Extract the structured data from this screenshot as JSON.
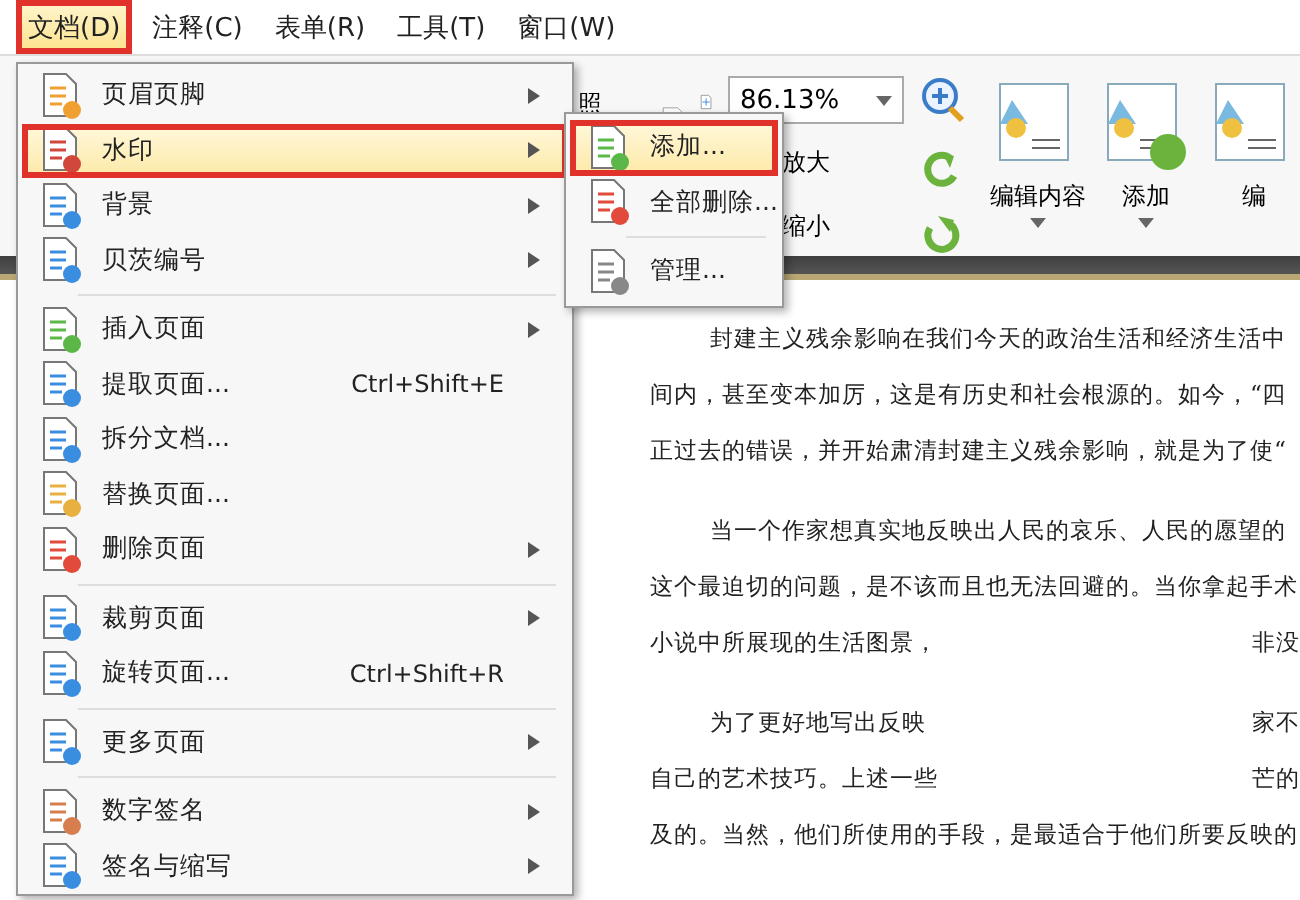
{
  "menu_bar": [
    {
      "label": "文档(D)",
      "selected": true,
      "outlined": true
    },
    {
      "label": "注释(C)",
      "selected": false,
      "outlined": false
    },
    {
      "label": "表单(R)",
      "selected": false,
      "outlined": false
    },
    {
      "label": "工具(T)",
      "selected": false,
      "outlined": false
    },
    {
      "label": "窗口(W)",
      "selected": false,
      "outlined": false
    }
  ],
  "ribbon": {
    "cut_label": "照",
    "zoom_field": {
      "value": "86.13%"
    },
    "zoom_in": "放大",
    "zoom_out": "缩小",
    "buttons": [
      {
        "label": "编辑内容",
        "dropdown": true
      },
      {
        "label": "添加",
        "dropdown": true
      },
      {
        "label": "编",
        "dropdown": false
      }
    ]
  },
  "document_menu": [
    {
      "kind": "item",
      "label": "页眉页脚",
      "submenu": true,
      "selected": false,
      "outlined": false
    },
    {
      "kind": "item",
      "label": "水印",
      "submenu": true,
      "selected": true,
      "outlined": true
    },
    {
      "kind": "item",
      "label": "背景",
      "submenu": true,
      "selected": false,
      "outlined": false
    },
    {
      "kind": "item",
      "label": "贝茨编号",
      "submenu": true,
      "selected": false,
      "outlined": false
    },
    {
      "kind": "separator"
    },
    {
      "kind": "item",
      "label": "插入页面",
      "submenu": true,
      "selected": false,
      "outlined": false
    },
    {
      "kind": "item",
      "label": "提取页面...",
      "shortcut": "Ctrl+Shift+E",
      "submenu": false,
      "selected": false,
      "outlined": false
    },
    {
      "kind": "item",
      "label": "拆分文档...",
      "submenu": false,
      "selected": false,
      "outlined": false
    },
    {
      "kind": "item",
      "label": "替换页面...",
      "submenu": false,
      "selected": false,
      "outlined": false
    },
    {
      "kind": "item",
      "label": "删除页面",
      "submenu": true,
      "selected": false,
      "outlined": false
    },
    {
      "kind": "separator"
    },
    {
      "kind": "item",
      "label": "裁剪页面",
      "submenu": true,
      "selected": false,
      "outlined": false
    },
    {
      "kind": "item",
      "label": "旋转页面...",
      "shortcut": "Ctrl+Shift+R",
      "submenu": false,
      "selected": false,
      "outlined": false
    },
    {
      "kind": "separator"
    },
    {
      "kind": "item",
      "label": "更多页面",
      "submenu": true,
      "selected": false,
      "outlined": false
    },
    {
      "kind": "separator"
    },
    {
      "kind": "item",
      "label": "数字签名",
      "submenu": true,
      "selected": false,
      "outlined": false
    },
    {
      "kind": "item",
      "label": "签名与缩写",
      "submenu": true,
      "selected": false,
      "outlined": false
    }
  ],
  "watermark_submenu": [
    {
      "kind": "item",
      "label": "添加...",
      "selected": true,
      "outlined": true
    },
    {
      "kind": "item",
      "label": "全部删除...",
      "selected": false,
      "outlined": false
    },
    {
      "kind": "separator"
    },
    {
      "kind": "item",
      "label": "管理...",
      "selected": false,
      "outlined": false
    }
  ],
  "document": {
    "paragraphs": [
      {
        "lines": [
          [
            "封建主义残余影响在我们今天的政治生活和经济生活中"
          ],
          [
            "间内，甚至变本加厉，这是有历史和社会根源的。如今，“四"
          ],
          [
            "正过去的错误，并开始肃清封建主义残余影响，就是为了使“"
          ]
        ]
      },
      {
        "lines": [
          [
            "当一个作家想真实地反映出人民的哀乐、人民的愿望的"
          ],
          [
            "这个最迫切的问题，是不该而且也无法回避的。当你拿起手术"
          ],
          [
            "小说中所展现的生活图景，",
            "非没"
          ]
        ]
      },
      {
        "lines": [
          [
            "为了更好地写出反映",
            "家不"
          ],
          [
            "自己的艺术技巧。上述一些",
            "芒的"
          ],
          [
            "及的。当然，他们所使用的手段，是最适合于他们所要反映的"
          ]
        ]
      }
    ]
  }
}
